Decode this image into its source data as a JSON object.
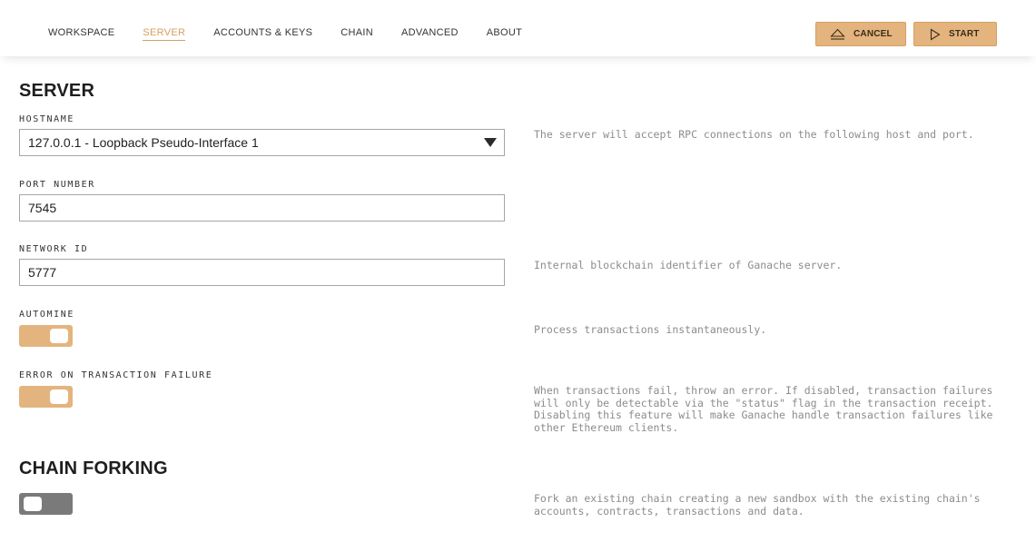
{
  "nav": {
    "items": [
      {
        "label": "WORKSPACE",
        "active": false
      },
      {
        "label": "SERVER",
        "active": true
      },
      {
        "label": "ACCOUNTS & KEYS",
        "active": false
      },
      {
        "label": "CHAIN",
        "active": false
      },
      {
        "label": "ADVANCED",
        "active": false
      },
      {
        "label": "ABOUT",
        "active": false
      }
    ]
  },
  "actions": {
    "cancel_label": "CANCEL",
    "start_label": "START"
  },
  "colors": {
    "accent": "#e4b47e",
    "accent_text": "#d4a061",
    "toggle_off": "#7a7a7a",
    "description_text": "#8c8c8c"
  },
  "server": {
    "title": "SERVER",
    "hostname": {
      "label": "HOSTNAME",
      "value": "127.0.0.1 - Loopback Pseudo-Interface 1",
      "description": "The server will accept RPC connections on the following host and port."
    },
    "port": {
      "label": "PORT NUMBER",
      "value": "7545"
    },
    "network_id": {
      "label": "NETWORK ID",
      "value": "5777",
      "description": "Internal blockchain identifier of Ganache server."
    },
    "automine": {
      "label": "AUTOMINE",
      "enabled": true,
      "description": "Process transactions instantaneously."
    },
    "error_on_failure": {
      "label": "ERROR ON TRANSACTION FAILURE",
      "enabled": true,
      "description": "When transactions fail, throw an error. If disabled, transaction failures will only be detectable via the \"status\" flag in the transaction receipt. Disabling this feature will make Ganache handle transaction failures like other Ethereum clients."
    }
  },
  "chain_forking": {
    "title": "CHAIN FORKING",
    "enabled": false,
    "description": "Fork an existing chain creating a new sandbox with the existing chain's accounts, contracts, transactions and data."
  }
}
